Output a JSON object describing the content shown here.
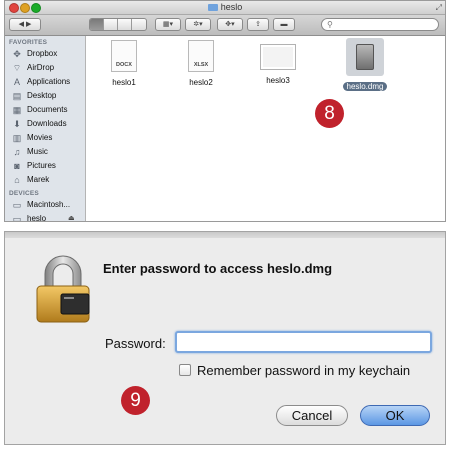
{
  "finder": {
    "title": "heslo",
    "search_placeholder": "",
    "sidebar": {
      "favorites_header": "FAVORITES",
      "favorites": [
        {
          "label": "Dropbox",
          "icon": "dropbox-icon",
          "glyph": "✥"
        },
        {
          "label": "AirDrop",
          "icon": "airdrop-icon",
          "glyph": "⌔"
        },
        {
          "label": "Applications",
          "icon": "applications-icon",
          "glyph": "A"
        },
        {
          "label": "Desktop",
          "icon": "desktop-icon",
          "glyph": "▤"
        },
        {
          "label": "Documents",
          "icon": "documents-icon",
          "glyph": "▦"
        },
        {
          "label": "Downloads",
          "icon": "downloads-icon",
          "glyph": "⬇"
        },
        {
          "label": "Movies",
          "icon": "movies-icon",
          "glyph": "▥"
        },
        {
          "label": "Music",
          "icon": "music-icon",
          "glyph": "♫"
        },
        {
          "label": "Pictures",
          "icon": "pictures-icon",
          "glyph": "◙"
        },
        {
          "label": "Marek",
          "icon": "home-icon",
          "glyph": "⌂"
        }
      ],
      "devices_header": "DEVICES",
      "devices": [
        {
          "label": "Macintosh...",
          "icon": "hard-disk-icon",
          "glyph": "▭"
        },
        {
          "label": "heslo",
          "icon": "disk-image-icon",
          "glyph": "▭"
        }
      ]
    },
    "files": [
      {
        "name": "heslo1",
        "kind": "docx",
        "tag": "DOCX"
      },
      {
        "name": "heslo2",
        "kind": "xlsx",
        "tag": "XLSX"
      },
      {
        "name": "heslo3",
        "kind": "blank"
      },
      {
        "name": "heslo.dmg",
        "kind": "dmg",
        "selected": true
      }
    ]
  },
  "step_badges": {
    "first": "8",
    "second": "9"
  },
  "dialog": {
    "title": "Enter password to access heslo.dmg",
    "password_label": "Password:",
    "password_value": "",
    "remember_label": "Remember password in my keychain",
    "remember_checked": false,
    "cancel_label": "Cancel",
    "ok_label": "OK"
  },
  "colors": {
    "badge": "#c0222c",
    "default_button": "#5c97e4",
    "sidebar_bg": "#dfe4ea",
    "selection": "#5b6f86"
  }
}
